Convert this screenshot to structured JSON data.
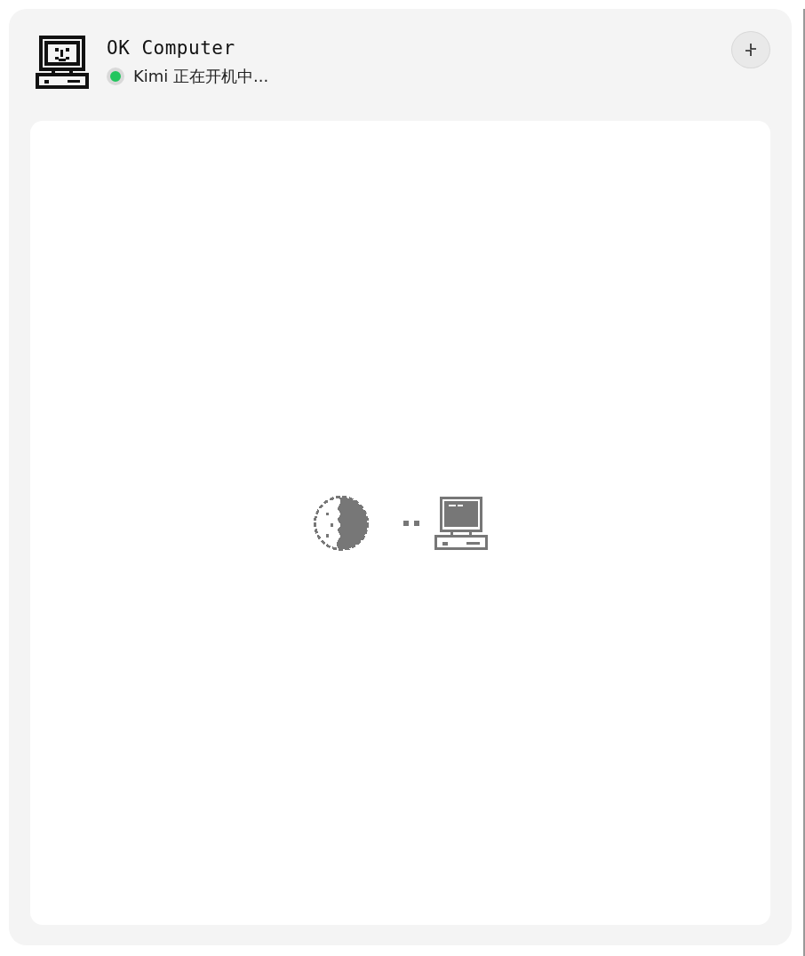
{
  "header": {
    "title": "OK Computer",
    "status": {
      "text": "Kimi 正在开机中...",
      "active": true
    }
  },
  "content": {
    "kind": "connecting"
  }
}
